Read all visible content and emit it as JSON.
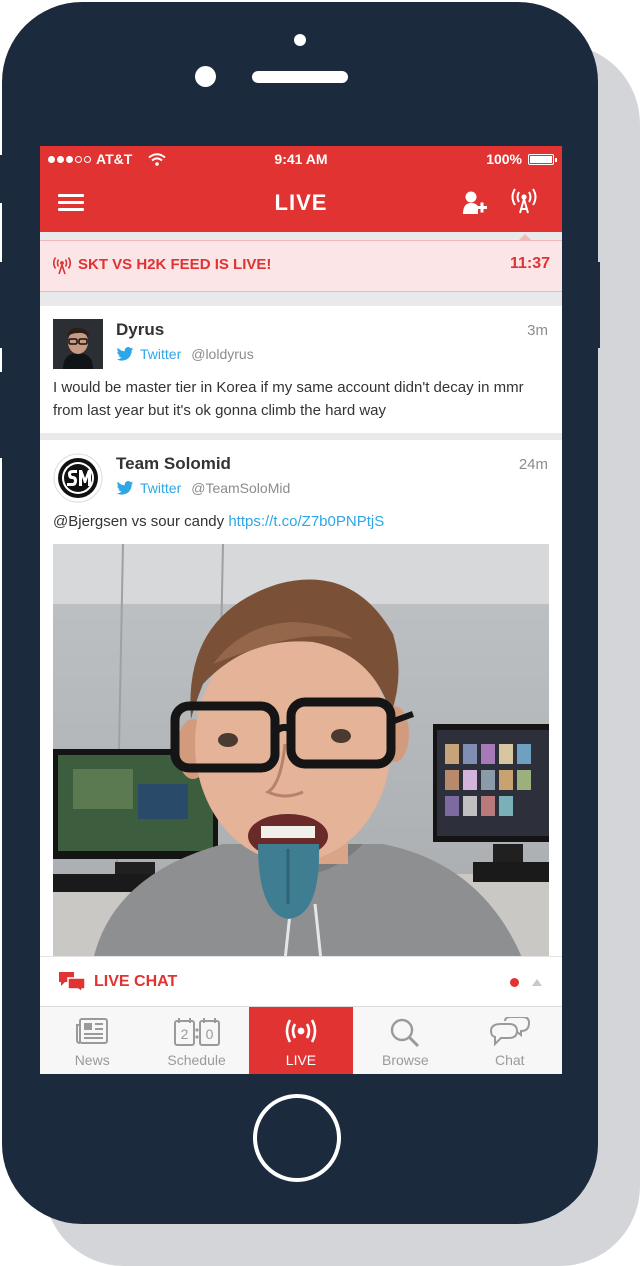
{
  "status_bar": {
    "carrier": "AT&T",
    "time": "9:41 AM",
    "battery": "100%"
  },
  "nav": {
    "title": "LIVE"
  },
  "banner": {
    "text": "SKT VS H2K FEED IS LIVE!",
    "time": "11:37"
  },
  "tweets": [
    {
      "author": "Dyrus",
      "source": "Twitter",
      "handle": "@loldyrus",
      "time": "3m",
      "text": "I would be master tier in Korea if my same account didn't decay in mmr from last year but it's ok gonna climb the hard way"
    },
    {
      "author": "Team Solomid",
      "source": "Twitter",
      "handle": "@TeamSoloMid",
      "time": "24m",
      "text": "@Bjergsen vs sour candy ",
      "link": "https://t.co/Z7b0PNPtjS"
    }
  ],
  "live_chat": {
    "label": "LIVE CHAT"
  },
  "tabs": [
    {
      "label": "News",
      "icon": "newspaper-icon"
    },
    {
      "label": "Schedule",
      "icon": "calendar-icon",
      "digits": [
        "2",
        "0"
      ]
    },
    {
      "label": "LIVE",
      "icon": "broadcast-icon",
      "active": true
    },
    {
      "label": "Browse",
      "icon": "search-icon"
    },
    {
      "label": "Chat",
      "icon": "chat-bubbles-icon"
    }
  ],
  "colors": {
    "accent": "#e03332",
    "twitter": "#2da7e7",
    "phone_body": "#1c2a3d"
  }
}
